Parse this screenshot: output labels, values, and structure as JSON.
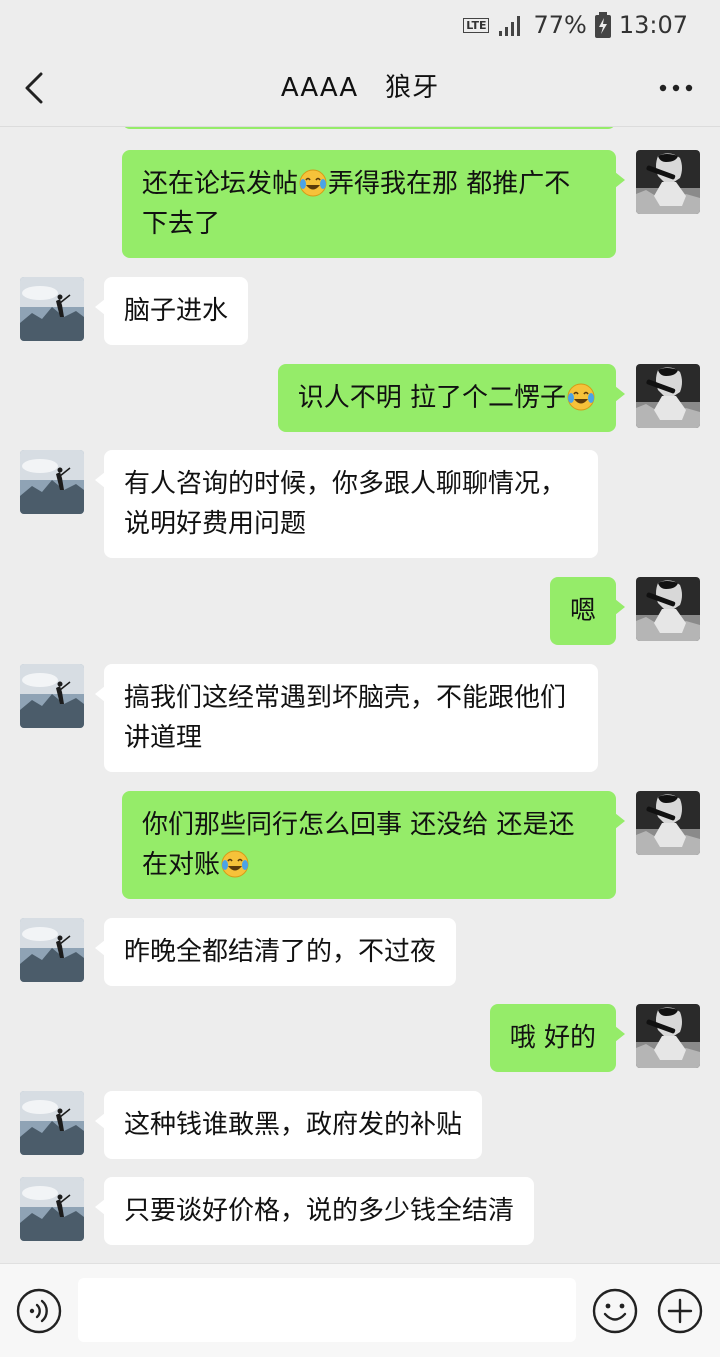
{
  "status_bar": {
    "network": "LTE",
    "battery": "77%",
    "time": "13:07"
  },
  "header": {
    "title": "AAAA　狼牙",
    "back_icon": "chevron-left-icon",
    "more_icon": "more-dots-icon"
  },
  "messages": [
    {
      "from": "self",
      "text": "还在论坛发帖😂弄得我在那 都推广不下去了"
    },
    {
      "from": "other",
      "text": "脑子进水"
    },
    {
      "from": "self",
      "text": "识人不明 拉了个二愣子😂"
    },
    {
      "from": "other",
      "text": "有人咨询的时候，你多跟人聊聊情况，说明好费用问题"
    },
    {
      "from": "self",
      "text": "嗯"
    },
    {
      "from": "other",
      "text": "搞我们这经常遇到坏脑壳，不能跟他们讲道理"
    },
    {
      "from": "self",
      "text": "你们那些同行怎么回事 还没给 还是还在对账😂"
    },
    {
      "from": "other",
      "text": "昨晚全都结清了的，不过夜"
    },
    {
      "from": "self",
      "text": "哦 好的"
    },
    {
      "from": "other",
      "text": "这种钱谁敢黑，政府发的补贴"
    },
    {
      "from": "other",
      "text": "只要谈好价格，说的多少钱全结清"
    }
  ],
  "input_bar": {
    "value": "",
    "voice_icon": "voice-icon",
    "emoji_icon": "emoji-icon",
    "plus_icon": "plus-icon"
  },
  "colors": {
    "self_bubble": "#95ec69",
    "other_bubble": "#ffffff",
    "background": "#ededed"
  }
}
